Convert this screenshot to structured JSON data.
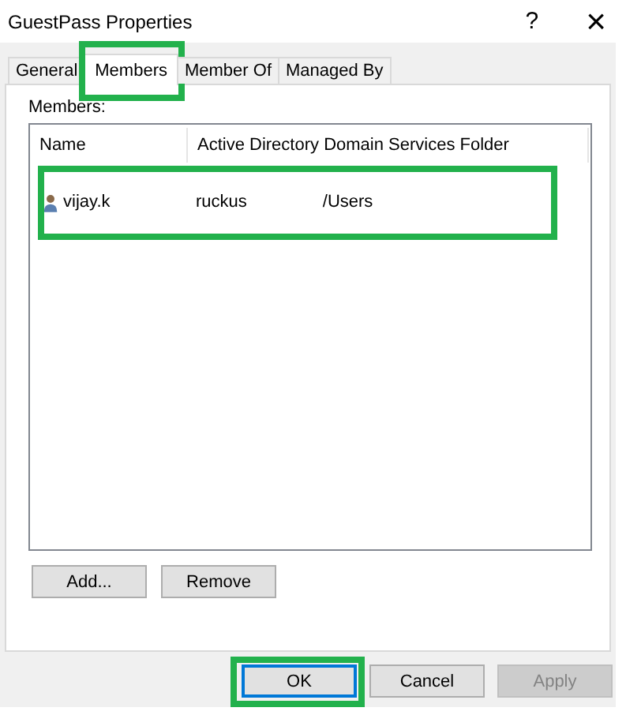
{
  "window": {
    "title": "GuestPass Properties",
    "help": "?",
    "close": "×"
  },
  "tabs": [
    {
      "label": "General",
      "selected": false,
      "highlighted": false
    },
    {
      "label": "Members",
      "selected": true,
      "highlighted": true
    },
    {
      "label": "Member Of",
      "selected": false,
      "highlighted": false
    },
    {
      "label": "Managed By",
      "selected": false,
      "highlighted": false
    }
  ],
  "members_label": "Members:",
  "table": {
    "columns": [
      "Name",
      "Active Directory Domain Services Folder"
    ],
    "rows": [
      {
        "name": "vijay.k",
        "folder_start": "ruckus",
        "folder_end": "/Users",
        "highlighted": true
      }
    ]
  },
  "list_buttons": [
    "Add...",
    "Remove"
  ],
  "buttons": [
    {
      "label": "OK",
      "default": true,
      "disabled": false,
      "highlighted": true
    },
    {
      "label": "Cancel",
      "default": false,
      "disabled": false,
      "highlighted": false
    },
    {
      "label": "Apply",
      "default": false,
      "disabled": true,
      "highlighted": false
    }
  ]
}
